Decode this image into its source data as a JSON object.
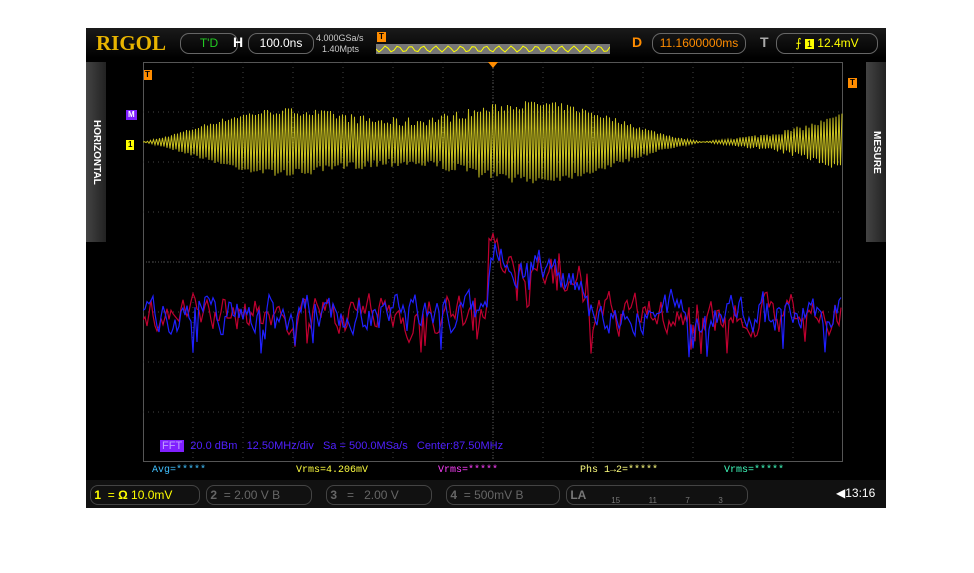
{
  "header": {
    "brand": "RIGOL",
    "status": "T'D",
    "h_label": "H",
    "timebase": "100.0ns",
    "sample_rate": "4.000GSa/s",
    "memory_depth": "1.40Mpts",
    "delay_label": "D",
    "delay": "11.1600000ms",
    "trigger_label": "T",
    "trigger_source": "1",
    "trigger_level": "12.4mV"
  },
  "side": {
    "left_tab": "HORIZONTAL",
    "right_tab": "MESURE"
  },
  "markers": {
    "trigger": "T",
    "math": "M",
    "ch1": "1"
  },
  "fft": {
    "badge": "FFT",
    "scale": "20.0 dBm",
    "hscale": "12.50MHz/div",
    "sa": "Sa = 500.0MSa/s",
    "center": "Center:87.50MHz"
  },
  "measurements": [
    {
      "text": "Avg=*****",
      "color": "#40c0ff"
    },
    {
      "text": "Vrms=4.206mV",
      "color": "#ffff40"
    },
    {
      "text": "Vrms=*****",
      "color": "#ff40ff"
    },
    {
      "text": "Phs 1→2=*****",
      "color": "#ffff80"
    },
    {
      "text": "Vrms=*****",
      "color": "#40ffc0"
    }
  ],
  "channels": [
    {
      "num": "1",
      "coupling": "=",
      "impedance": "Ω",
      "scale": "10.0mV",
      "active": true
    },
    {
      "num": "2",
      "coupling": "=",
      "scale": "2.00 V",
      "bw": "B",
      "active": false
    },
    {
      "num": "3",
      "coupling": "=",
      "scale": "2.00 V",
      "active": false
    },
    {
      "num": "4",
      "coupling": "=",
      "scale": "500mV",
      "bw": "B",
      "active": false
    }
  ],
  "la": {
    "label": "LA",
    "ticks": [
      "15",
      "11",
      "7",
      "3"
    ]
  },
  "clock": "13:16",
  "colors": {
    "ch1": "#c8c020",
    "fft_red": "#c00030",
    "fft_blue": "#2020ff",
    "accent": "#e8b400",
    "delay": "#ff8c00"
  }
}
